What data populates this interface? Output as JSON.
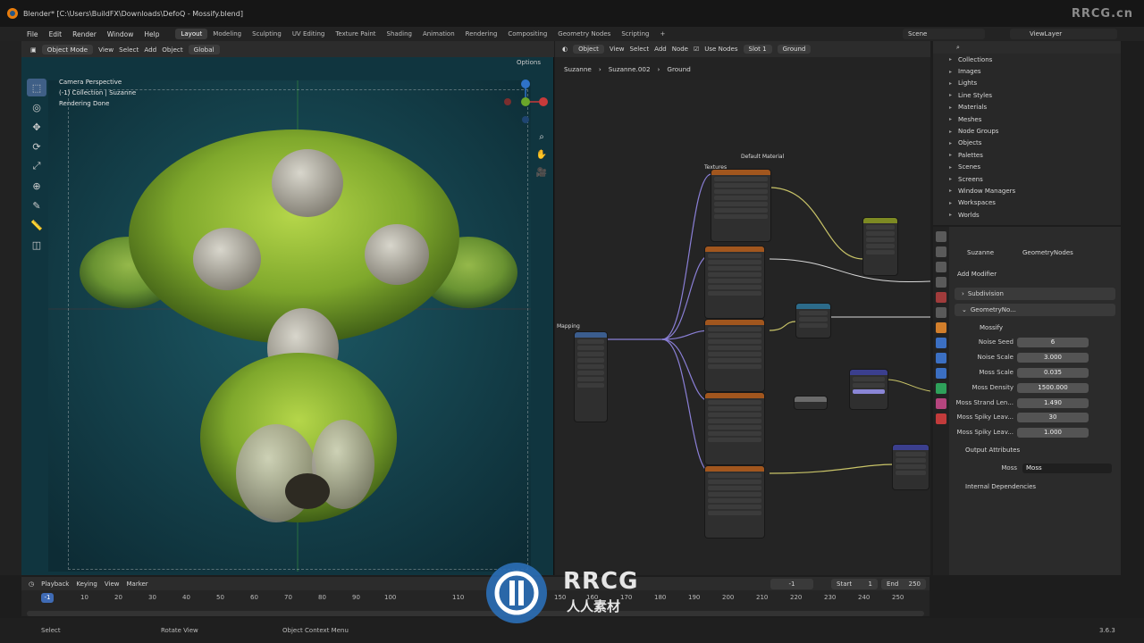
{
  "window": {
    "title": "Blender* [C:\\Users\\BuildFX\\Downloads\\DefoQ - Mossify.blend]",
    "watermark": "RRCG.cn"
  },
  "menu": [
    "File",
    "Edit",
    "Render",
    "Window",
    "Help"
  ],
  "workspaces": [
    "Layout",
    "Modeling",
    "Sculpting",
    "UV Editing",
    "Texture Paint",
    "Shading",
    "Animation",
    "Rendering",
    "Compositing",
    "Geometry Nodes",
    "Scripting"
  ],
  "scene": "Scene",
  "view_layer": "ViewLayer",
  "viewport": {
    "mode": "Object Mode",
    "menus": [
      "View",
      "Select",
      "Add",
      "Object"
    ],
    "transform": "Global",
    "options": "Options",
    "overlay": [
      "Camera Perspective",
      "(-1) Collection | Suzanne",
      "Rendering Done"
    ]
  },
  "node_editor": {
    "type": "Object",
    "menus": [
      "View",
      "Select",
      "Add",
      "Node"
    ],
    "use_nodes": "Use Nodes",
    "slot": "Slot 1",
    "material": "Ground",
    "breadcrumb": [
      "Suzanne",
      "Suzanne.002",
      "Ground"
    ],
    "frame_title": "Default Material",
    "textures_label": "Textures",
    "mapping_label": "Mapping"
  },
  "outliner": {
    "items": [
      "Collections",
      "Images",
      "Lights",
      "Line Styles",
      "Materials",
      "Meshes",
      "Node Groups",
      "Objects",
      "Palettes",
      "Scenes",
      "Screens",
      "Window Managers",
      "Workspaces",
      "Worlds"
    ]
  },
  "properties": {
    "object": "Suzanne",
    "modifier_tab": "GeometryNodes",
    "add_modifier": "Add Modifier",
    "modifiers": [
      "Subdivision",
      "GeometryNo..."
    ],
    "node_group": "Mossify",
    "params": [
      {
        "label": "Noise Seed",
        "value": "6"
      },
      {
        "label": "Noise Scale",
        "value": "3.000"
      },
      {
        "label": "Moss Scale",
        "value": "0.035"
      },
      {
        "label": "Moss Density",
        "value": "1500.000"
      },
      {
        "label": "Moss Strand Len...",
        "value": "1.490"
      },
      {
        "label": "Moss Spiky Leav...",
        "value": "30"
      },
      {
        "label": "Moss Spiky Leav...",
        "value": "1.000"
      }
    ],
    "output_attributes": "Output Attributes",
    "moss_label": "Moss",
    "moss_value": "Moss",
    "internal_deps": "Internal Dependencies"
  },
  "timeline": {
    "menus": [
      "Playback",
      "Keying",
      "View",
      "Marker"
    ],
    "current_frame": "-1",
    "frame_field": "-1",
    "start_label": "Start",
    "start": "1",
    "end_label": "End",
    "end": "250",
    "ticks": [
      "10",
      "20",
      "30",
      "40",
      "50",
      "60",
      "70",
      "80",
      "90",
      "100",
      "110",
      "150",
      "160",
      "170",
      "180",
      "190",
      "200",
      "210",
      "220",
      "230",
      "240",
      "250"
    ]
  },
  "status": {
    "select": "Select",
    "rotate": "Rotate View",
    "context": "Object Context Menu",
    "version": "3.6.3"
  },
  "brand": {
    "logo_text": "RRCG",
    "logo_sub": "人人素材"
  }
}
